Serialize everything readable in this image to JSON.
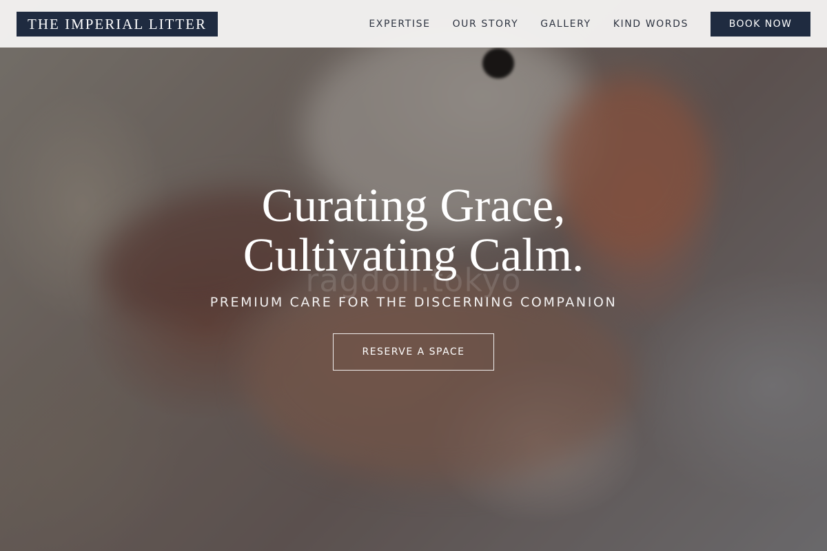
{
  "header": {
    "brand": "THE IMPERIAL LITTER",
    "nav_items": [
      "EXPERTISE",
      "OUR STORY",
      "GALLERY",
      "KIND WORDS"
    ],
    "cta_label": "BOOK NOW"
  },
  "hero": {
    "headline_line1": "Curating Grace,",
    "headline_line2": "Cultivating Calm.",
    "subheadline": "PREMIUM CARE FOR THE DISCERNING COMPANION",
    "cta_label": "RESERVE A SPACE",
    "watermark": "ragdoll.tokyo"
  },
  "colors": {
    "brand_navy": "#1f2b40",
    "nav_background": "#f3f2f1",
    "nav_text": "#2d3340",
    "hero_text": "#ffffff"
  }
}
